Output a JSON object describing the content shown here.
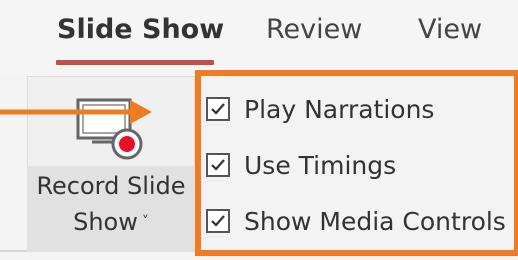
{
  "tabs": [
    {
      "label": "Slide Show",
      "active": true
    },
    {
      "label": "Review",
      "active": false
    },
    {
      "label": "View",
      "active": false
    }
  ],
  "record_button": {
    "line1": "Record Slide",
    "line2": "Show",
    "icon": "record-slide-show-icon",
    "chevron": "˅"
  },
  "checkboxes": [
    {
      "label": "Play Narrations",
      "checked": true
    },
    {
      "label": "Use Timings",
      "checked": true
    },
    {
      "label": "Show Media Controls",
      "checked": true
    }
  ],
  "colors": {
    "highlight": "#f07b22",
    "tab_underline": "#c0504d",
    "record_dot": "#e81123"
  }
}
